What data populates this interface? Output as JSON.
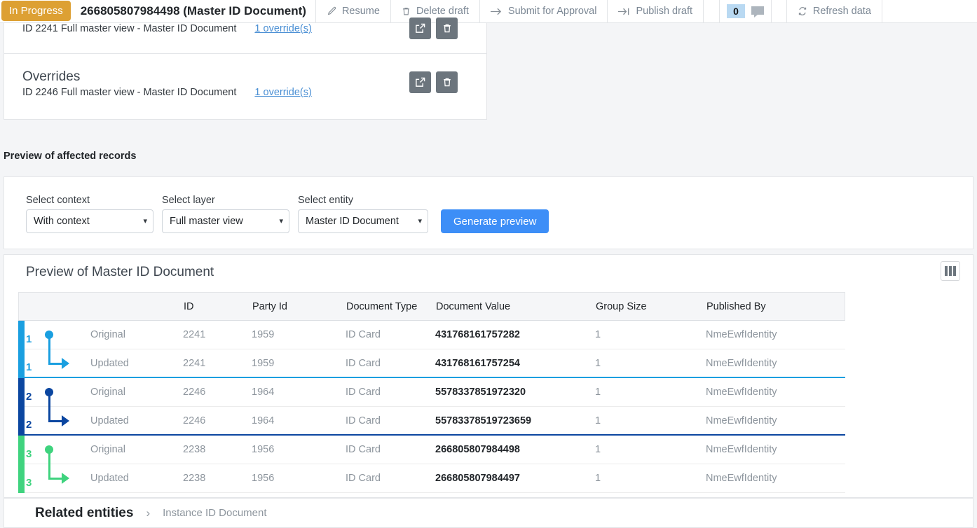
{
  "toolbar": {
    "status_badge": "In Progress",
    "doc_title": "266805807984498 (Master ID Document)",
    "buttons": [
      {
        "label": "Resume",
        "icon": "pencil-icon",
        "glyph": "✎"
      },
      {
        "label": "Delete draft",
        "icon": "trash-icon",
        "glyph": "🗑"
      },
      {
        "label": "Submit for Approval",
        "icon": "arrow-right-icon",
        "glyph": "→"
      },
      {
        "label": "Publish draft",
        "icon": "arrow-to-end-icon",
        "glyph": "↦"
      }
    ],
    "comment_count": "0",
    "comment_icon": "comment-bubble-icon",
    "refresh": {
      "label": "Refresh data",
      "icon": "refresh-icon",
      "glyph": "↻"
    }
  },
  "overrides": {
    "row_top": {
      "description": "ID 2241 Full master view - Master ID Document",
      "link": "1 override(s)"
    },
    "heading": "Overrides",
    "row_second": {
      "description": "ID 2246 Full master view - Master ID Document",
      "link": "1 override(s)"
    },
    "actions": {
      "open_icon": "external-link-icon",
      "delete_icon": "trash-icon"
    }
  },
  "affected": {
    "section_label": "Preview of affected records",
    "filters": [
      {
        "label": "Select context",
        "value": "With context",
        "name": "context-select"
      },
      {
        "label": "Select layer",
        "value": "Full master view",
        "name": "layer-select"
      },
      {
        "label": "Select entity",
        "value": "Master ID Document",
        "name": "entity-select"
      }
    ],
    "generate_button": "Generate preview"
  },
  "preview": {
    "title": "Preview of Master ID Document",
    "columns_icon": "columns-settings-icon",
    "columns": [
      "",
      "",
      "ID",
      "Party Id",
      "Document Type",
      "Document Value",
      "Group Size",
      "Published By"
    ],
    "groups": [
      {
        "number": "1",
        "color": "#1a9fe0",
        "rows": [
          {
            "kind": "Original",
            "id": "2241",
            "party_id": "1959",
            "doc_type": "ID Card",
            "doc_value": "431768161757282",
            "group_size": "1",
            "published_by": "NmeEwfIdentity"
          },
          {
            "kind": "Updated",
            "id": "2241",
            "party_id": "1959",
            "doc_type": "ID Card",
            "doc_value": "431768161757254",
            "group_size": "1",
            "published_by": "NmeEwfIdentity"
          }
        ]
      },
      {
        "number": "2",
        "color": "#0b46a0",
        "rows": [
          {
            "kind": "Original",
            "id": "2246",
            "party_id": "1964",
            "doc_type": "ID Card",
            "doc_value": "5578337851972320",
            "group_size": "1",
            "published_by": "NmeEwfIdentity"
          },
          {
            "kind": "Updated",
            "id": "2246",
            "party_id": "1964",
            "doc_type": "ID Card",
            "doc_value": "55783378519723659",
            "group_size": "1",
            "published_by": "NmeEwfIdentity"
          }
        ]
      },
      {
        "number": "3",
        "color": "#3fd37e",
        "rows": [
          {
            "kind": "Original",
            "id": "2238",
            "party_id": "1956",
            "doc_type": "ID Card",
            "doc_value": "266805807984498",
            "group_size": "1",
            "published_by": "NmeEwfIdentity"
          },
          {
            "kind": "Updated",
            "id": "2238",
            "party_id": "1956",
            "doc_type": "ID Card",
            "doc_value": "266805807984497",
            "group_size": "1",
            "published_by": "NmeEwfIdentity"
          }
        ]
      }
    ]
  },
  "related": {
    "title": "Related entities",
    "chevron": "›",
    "items": [
      "Instance ID Document"
    ]
  },
  "colors": {
    "status": "#dda033",
    "primary": "#3d8ef7",
    "group1": "#1a9fe0",
    "group2": "#0b46a0",
    "group3": "#3fd37e"
  }
}
